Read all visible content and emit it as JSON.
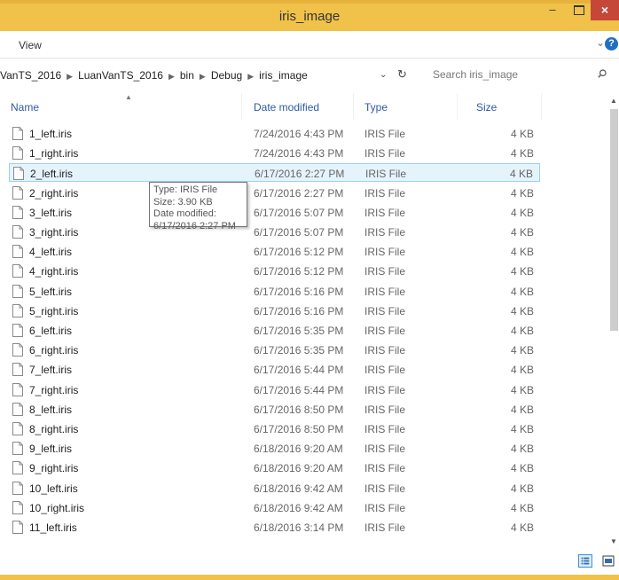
{
  "window": {
    "title": "iris_image",
    "minimize": "–",
    "close": "×"
  },
  "ribbon": {
    "view_tab": "View",
    "expand_chevron": "⌄",
    "help": "?"
  },
  "address": {
    "crumbs": [
      "VanTS_2016",
      "LuanVanTS_2016",
      "bin",
      "Debug",
      "iris_image"
    ],
    "separator": "▶",
    "dropdown_glyph": "⌄",
    "refresh_glyph": "↻"
  },
  "search": {
    "placeholder": "Search iris_image"
  },
  "columns": {
    "name": "Name",
    "date": "Date modified",
    "type": "Type",
    "size": "Size"
  },
  "files": [
    {
      "name": "1_left.iris",
      "date": "7/24/2016 4:43 PM",
      "type": "IRIS File",
      "size": "4 KB"
    },
    {
      "name": "1_right.iris",
      "date": "7/24/2016 4:43 PM",
      "type": "IRIS File",
      "size": "4 KB"
    },
    {
      "name": "2_left.iris",
      "date": "6/17/2016 2:27 PM",
      "type": "IRIS File",
      "size": "4 KB",
      "selected": true
    },
    {
      "name": "2_right.iris",
      "date": "6/17/2016 2:27 PM",
      "type": "IRIS File",
      "size": "4 KB"
    },
    {
      "name": "3_left.iris",
      "date": "6/17/2016 5:07 PM",
      "type": "IRIS File",
      "size": "4 KB"
    },
    {
      "name": "3_right.iris",
      "date": "6/17/2016 5:07 PM",
      "type": "IRIS File",
      "size": "4 KB"
    },
    {
      "name": "4_left.iris",
      "date": "6/17/2016 5:12 PM",
      "type": "IRIS File",
      "size": "4 KB"
    },
    {
      "name": "4_right.iris",
      "date": "6/17/2016 5:12 PM",
      "type": "IRIS File",
      "size": "4 KB"
    },
    {
      "name": "5_left.iris",
      "date": "6/17/2016 5:16 PM",
      "type": "IRIS File",
      "size": "4 KB"
    },
    {
      "name": "5_right.iris",
      "date": "6/17/2016 5:16 PM",
      "type": "IRIS File",
      "size": "4 KB"
    },
    {
      "name": "6_left.iris",
      "date": "6/17/2016 5:35 PM",
      "type": "IRIS File",
      "size": "4 KB"
    },
    {
      "name": "6_right.iris",
      "date": "6/17/2016 5:35 PM",
      "type": "IRIS File",
      "size": "4 KB"
    },
    {
      "name": "7_left.iris",
      "date": "6/17/2016 5:44 PM",
      "type": "IRIS File",
      "size": "4 KB"
    },
    {
      "name": "7_right.iris",
      "date": "6/17/2016 5:44 PM",
      "type": "IRIS File",
      "size": "4 KB"
    },
    {
      "name": "8_left.iris",
      "date": "6/17/2016 8:50 PM",
      "type": "IRIS File",
      "size": "4 KB"
    },
    {
      "name": "8_right.iris",
      "date": "6/17/2016 8:50 PM",
      "type": "IRIS File",
      "size": "4 KB"
    },
    {
      "name": "9_left.iris",
      "date": "6/18/2016 9:20 AM",
      "type": "IRIS File",
      "size": "4 KB"
    },
    {
      "name": "9_right.iris",
      "date": "6/18/2016 9:20 AM",
      "type": "IRIS File",
      "size": "4 KB"
    },
    {
      "name": "10_left.iris",
      "date": "6/18/2016 9:42 AM",
      "type": "IRIS File",
      "size": "4 KB"
    },
    {
      "name": "10_right.iris",
      "date": "6/18/2016 9:42 AM",
      "type": "IRIS File",
      "size": "4 KB"
    },
    {
      "name": "11_left.iris",
      "date": "6/18/2016 3:14 PM",
      "type": "IRIS File",
      "size": "4 KB"
    }
  ],
  "tooltip": {
    "type_line": "Type: IRIS File",
    "size_line": "Size: 3.90 KB",
    "date_line": "Date modified: 6/17/2016 2:27 PM"
  },
  "scrollbar": {
    "up": "▲",
    "down": "▼"
  },
  "icons": {
    "file": "document-icon",
    "search": "search-icon",
    "details_view": "details-view-icon",
    "large_icons_view": "large-icons-view-icon"
  },
  "colors": {
    "titlebar": "#f0c24a",
    "close": "#c7463a",
    "selection_fill": "#e5f3fb",
    "selection_border": "#99d1ee",
    "header_text": "#2d5aa0"
  }
}
